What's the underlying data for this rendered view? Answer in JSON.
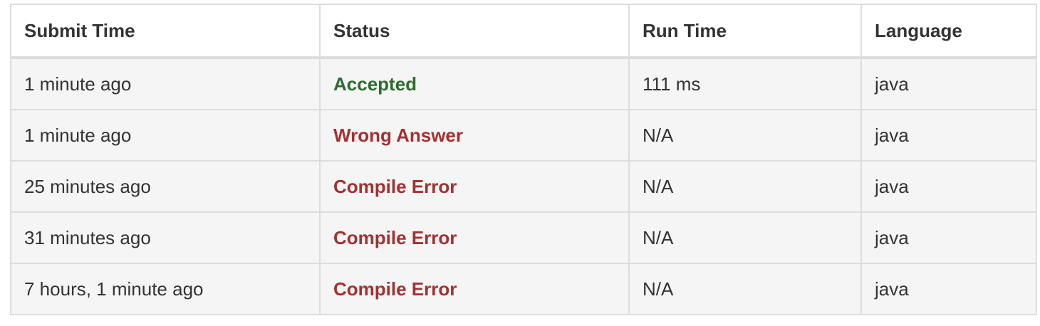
{
  "columns": {
    "submit_time": "Submit Time",
    "status": "Status",
    "run_time": "Run Time",
    "language": "Language"
  },
  "colors": {
    "accepted": "#2f6b2f",
    "error": "#a33131",
    "border": "#dddddd",
    "row_bg": "#f5f5f5"
  },
  "rows": [
    {
      "submit_time": "1 minute ago",
      "status": "Accepted",
      "status_kind": "accepted",
      "run_time": "111 ms",
      "language": "java"
    },
    {
      "submit_time": "1 minute ago",
      "status": "Wrong Answer",
      "status_kind": "error",
      "run_time": "N/A",
      "language": "java"
    },
    {
      "submit_time": "25 minutes ago",
      "status": "Compile Error",
      "status_kind": "error",
      "run_time": "N/A",
      "language": "java"
    },
    {
      "submit_time": "31 minutes ago",
      "status": "Compile Error",
      "status_kind": "error",
      "run_time": "N/A",
      "language": "java"
    },
    {
      "submit_time": "7 hours, 1 minute ago",
      "status": "Compile Error",
      "status_kind": "error",
      "run_time": "N/A",
      "language": "java"
    }
  ]
}
